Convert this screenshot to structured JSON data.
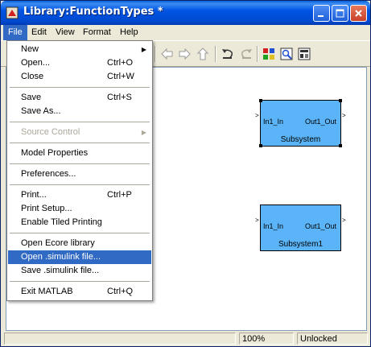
{
  "window": {
    "title": "Library:FunctionTypes *"
  },
  "menubar": {
    "items": [
      "File",
      "Edit",
      "View",
      "Format",
      "Help"
    ],
    "active": "File"
  },
  "file_menu": {
    "items": [
      {
        "label": "New",
        "shortcut": "",
        "submenu": true,
        "disabled": false,
        "highlighted": false
      },
      {
        "label": "Open...",
        "shortcut": "Ctrl+O",
        "submenu": false,
        "disabled": false,
        "highlighted": false
      },
      {
        "label": "Close",
        "shortcut": "Ctrl+W",
        "submenu": false,
        "disabled": false,
        "highlighted": false
      },
      {
        "label": "Save",
        "shortcut": "Ctrl+S",
        "submenu": false,
        "disabled": false,
        "highlighted": false
      },
      {
        "label": "Save As...",
        "shortcut": "",
        "submenu": false,
        "disabled": false,
        "highlighted": false
      },
      {
        "label": "Source Control",
        "shortcut": "",
        "submenu": true,
        "disabled": true,
        "highlighted": false
      },
      {
        "label": "Model Properties",
        "shortcut": "",
        "submenu": false,
        "disabled": false,
        "highlighted": false
      },
      {
        "label": "Preferences...",
        "shortcut": "",
        "submenu": false,
        "disabled": false,
        "highlighted": false
      },
      {
        "label": "Print...",
        "shortcut": "Ctrl+P",
        "submenu": false,
        "disabled": false,
        "highlighted": false
      },
      {
        "label": "Print Setup...",
        "shortcut": "",
        "submenu": false,
        "disabled": false,
        "highlighted": false
      },
      {
        "label": "Enable Tiled Printing",
        "shortcut": "",
        "submenu": false,
        "disabled": false,
        "highlighted": false
      },
      {
        "label": "Open Ecore library",
        "shortcut": "",
        "submenu": false,
        "disabled": false,
        "highlighted": false
      },
      {
        "label": "Open .simulink file...",
        "shortcut": "",
        "submenu": false,
        "disabled": false,
        "highlighted": true
      },
      {
        "label": "Save .simulink file...",
        "shortcut": "",
        "submenu": false,
        "disabled": false,
        "highlighted": false
      },
      {
        "label": "Exit MATLAB",
        "shortcut": "Ctrl+Q",
        "submenu": false,
        "disabled": false,
        "highlighted": false
      }
    ]
  },
  "toolbar": {
    "icons": [
      "back-arrow-icon",
      "forward-arrow-icon",
      "up-arrow-icon",
      "undo-icon",
      "redo-icon",
      "library-browser-icon",
      "model-explorer-icon",
      "debugger-icon"
    ]
  },
  "blocks": [
    {
      "name": "Subsystem",
      "in_port": "In1_In",
      "out_port": "Out1_Out"
    },
    {
      "name": "Subsystem1",
      "in_port": "In1_In",
      "out_port": "Out1_Out"
    }
  ],
  "status": {
    "zoom": "100%",
    "lock_state": "Unlocked"
  },
  "colors": {
    "title_bar": "#0054e3",
    "highlight": "#316ac5",
    "block_fill": "#5bb4f7"
  }
}
